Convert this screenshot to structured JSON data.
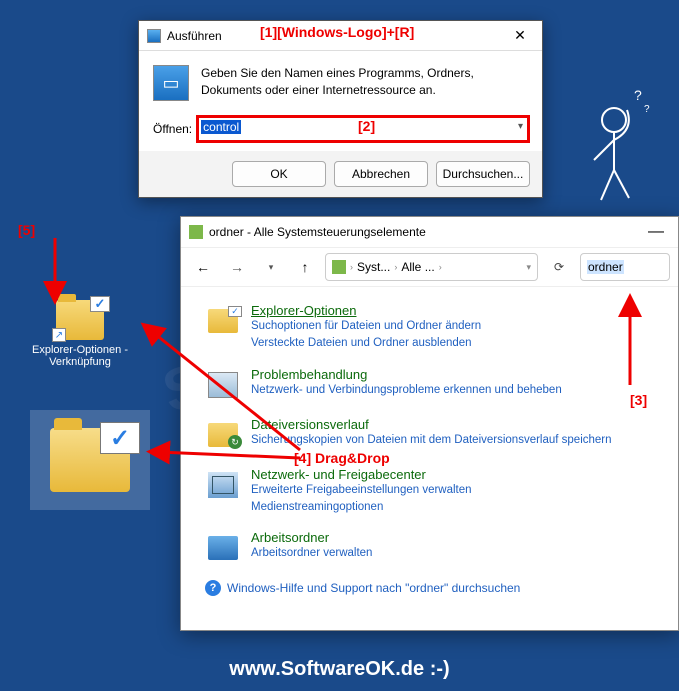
{
  "run": {
    "title": "Ausführen",
    "description": "Geben Sie den Namen eines Programms, Ordners, Dokuments oder einer Internetressource an.",
    "open_label": "Öffnen:",
    "value": "control",
    "ok": "OK",
    "cancel": "Abbrechen",
    "browse": "Durchsuchen..."
  },
  "cp": {
    "title": "ordner - Alle Systemsteuerungselemente",
    "crumb1": "Syst...",
    "crumb2": "Alle ...",
    "search": "ordner",
    "items": [
      {
        "title": "Explorer-Optionen",
        "subs": [
          "Suchoptionen für Dateien und Ordner ändern",
          "Versteckte Dateien und Ordner ausblenden"
        ]
      },
      {
        "title": "Problembehandlung",
        "subs": [
          "Netzwerk- und Verbindungsprobleme erkennen und beheben"
        ]
      },
      {
        "title": "Dateiversionsverlauf",
        "subs": [
          "Sicherungskopien von Dateien mit dem Dateiversionsverlauf speichern"
        ]
      },
      {
        "title": "Netzwerk- und Freigabecenter",
        "subs": [
          "Erweiterte Freigabeeinstellungen verwalten",
          "Medienstreamingoptionen"
        ]
      },
      {
        "title": "Arbeitsordner",
        "subs": [
          "Arbeitsordner verwalten"
        ]
      }
    ],
    "help": "Windows-Hilfe und Support nach \"ordner\" durchsuchen"
  },
  "desktop": {
    "icon_label": "Explorer-Optionen - Verknüpfung"
  },
  "annotations": {
    "a1": "[1][Windows-Logo]+[R]",
    "a2": "[2]",
    "a3": "[3]",
    "a4": "[4] Drag&Drop",
    "a5": "[5]"
  },
  "footer": "www.SoftwareOK.de :-)",
  "watermark": "SoftwareOK"
}
